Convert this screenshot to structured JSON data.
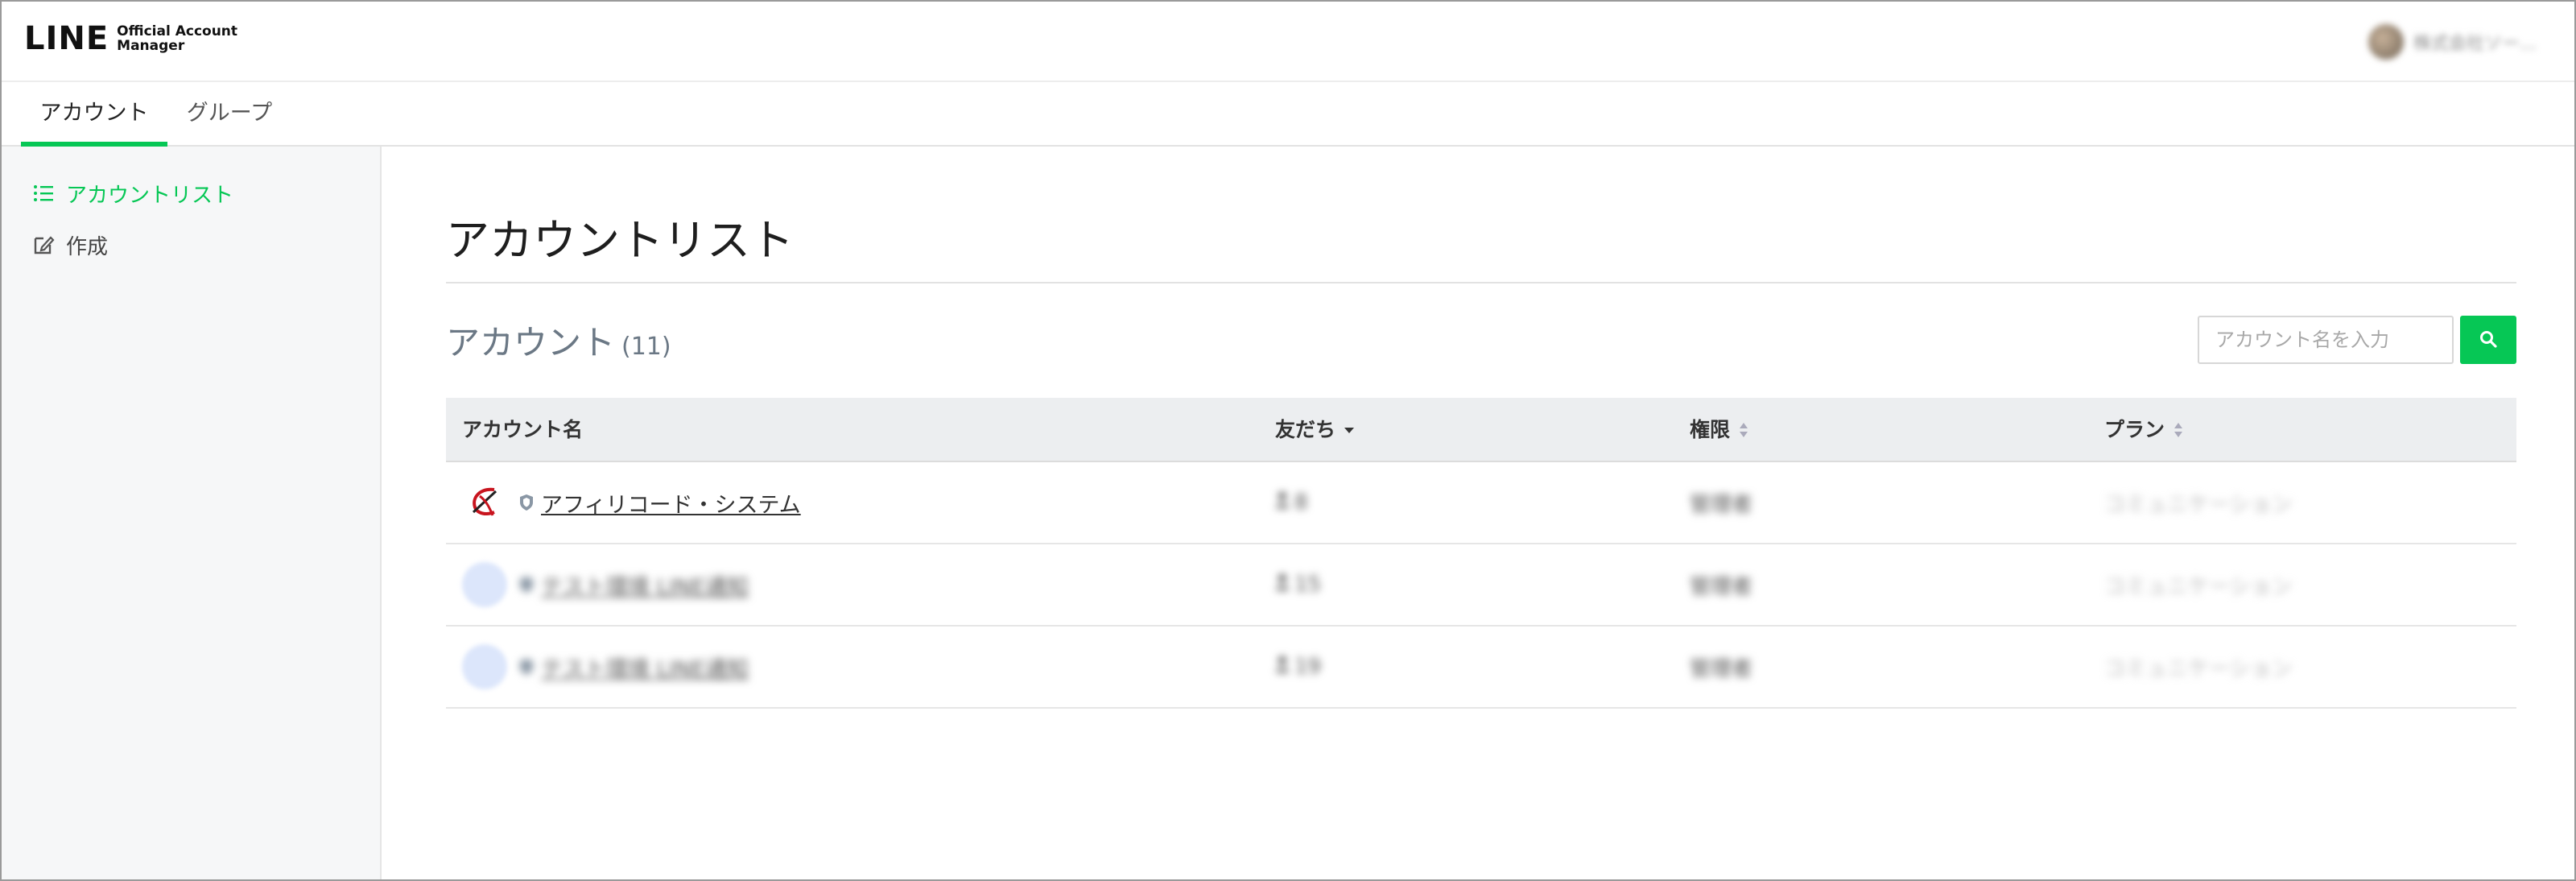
{
  "header": {
    "logo_main": "LINE",
    "logo_sub_line1": "Official Account",
    "logo_sub_line2": "Manager",
    "user_name": "株式会社ソー..."
  },
  "tabs": [
    {
      "label": "アカウント",
      "active": true
    },
    {
      "label": "グループ",
      "active": false
    }
  ],
  "sidebar": {
    "items": [
      {
        "label": "アカウントリスト",
        "icon": "list-icon",
        "active": true
      },
      {
        "label": "作成",
        "icon": "edit-icon",
        "active": false
      }
    ]
  },
  "main": {
    "page_title": "アカウントリスト",
    "section_title": "アカウント",
    "section_count": "(11)",
    "search": {
      "placeholder": "アカウント名を入力",
      "value": ""
    }
  },
  "table": {
    "headers": {
      "name": "アカウント名",
      "friends": "友だち",
      "role": "権限",
      "plan": "プラン"
    },
    "rows": [
      {
        "name": "アフィリコード・システム",
        "friends": "8",
        "role": "管理者",
        "plan": "コミュニケーション"
      },
      {
        "name": "テスト環境 LINE通知",
        "friends": "15",
        "role": "管理者",
        "plan": "コミュニケーション"
      },
      {
        "name": "テスト環境 LINE通知",
        "friends": "19",
        "role": "管理者",
        "plan": "コミュニケーション"
      }
    ]
  },
  "colors": {
    "accent": "#06c755",
    "header_bg": "#eceef0",
    "sidebar_bg": "#f6f7f8"
  }
}
